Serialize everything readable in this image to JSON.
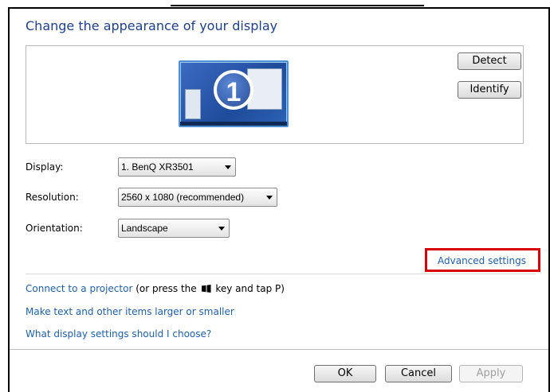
{
  "window": {
    "title": "Change the appearance of your display"
  },
  "preview": {
    "monitor_number": "1",
    "detect_label": "Detect",
    "identify_label": "Identify"
  },
  "fields": {
    "display": {
      "label": "Display:",
      "value": "1. BenQ XR3501"
    },
    "resolution": {
      "label": "Resolution:",
      "value": "2560 x 1080 (recommended)"
    },
    "orientation": {
      "label": "Orientation:",
      "value": "Landscape"
    }
  },
  "links": {
    "advanced": "Advanced settings",
    "projector_link": "Connect to a projector",
    "projector_text_before": "(or press the",
    "projector_text_after": "key and tap P)",
    "text_size": "Make text and other items larger or smaller",
    "help": "What display settings should I choose?"
  },
  "footer": {
    "ok": "OK",
    "cancel": "Cancel",
    "apply": "Apply"
  },
  "colors": {
    "accent": "#1f5fa8",
    "highlight_box": "#d90000"
  }
}
